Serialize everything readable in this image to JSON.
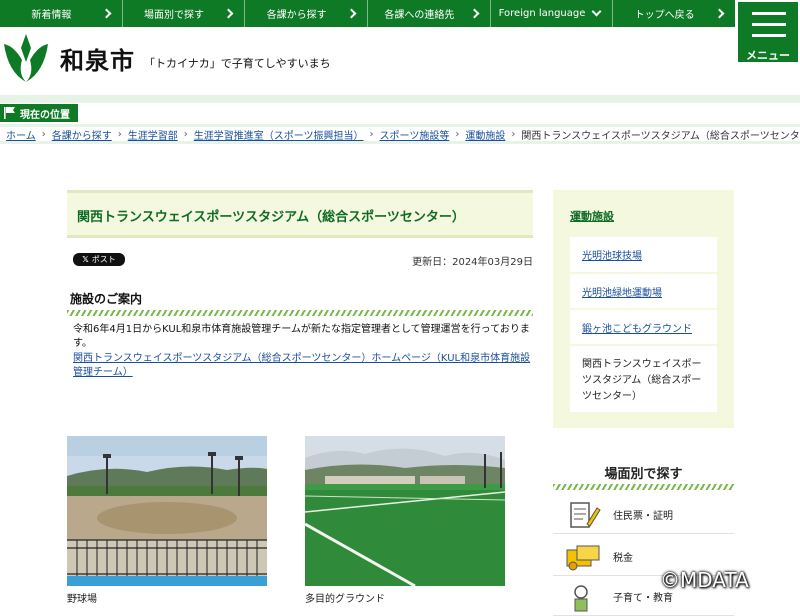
{
  "topnav": {
    "items": [
      {
        "label": "新着情報",
        "arrow": "right"
      },
      {
        "label": "場面別で探す",
        "arrow": "right"
      },
      {
        "label": "各課から探す",
        "arrow": "right"
      },
      {
        "label": "各課への連絡先",
        "arrow": "right"
      },
      {
        "label": "Foreign language",
        "arrow": "down"
      },
      {
        "label": "トップへ戻る",
        "arrow": "right"
      }
    ],
    "menu_label": "メニュー"
  },
  "header": {
    "logo_icon": "izumi-city-emblem",
    "site_name": "和泉市",
    "tagline": "「トカイナカ」で子育てしやすいまち"
  },
  "location": {
    "badge_label": "現在の位置",
    "breadcrumb": [
      "ホーム",
      "各課から探す",
      "生涯学習部",
      "生涯学習推進室（スポーツ振興担当）",
      "スポーツ施設等",
      "運動施設"
    ],
    "current": "関西トランスウェイスポーツスタジアム（総合スポーツセンター）",
    "separator": "›"
  },
  "main": {
    "page_title": "関西トランスウェイスポーツスタジアム（総合スポーツセンター）",
    "share_button": "ポスト",
    "updated": "更新日：2024年03月29日",
    "section_heading": "施設のご案内",
    "body_text": "令和6年4月1日からKUL和泉市体育施設管理チームが新たな指定管理者として管理運営を行っております。",
    "link_text": "関西トランスウェイスポーツスタジアム（総合スポーツセンター）ホームページ（KUL和泉市体育施設管理チーム）",
    "photos": [
      {
        "caption": "野球場"
      },
      {
        "caption": "多目的グラウンド"
      }
    ]
  },
  "sidebar": {
    "title": "運動施設",
    "items": [
      {
        "label": "光明池球技場"
      },
      {
        "label": "光明池緑地運動場"
      },
      {
        "label": "鍛ヶ池こどもグラウンド"
      }
    ],
    "current_item": "関西トランスウェイスポーツスタジアム（総合スポーツセンター）"
  },
  "scene": {
    "title": "場面別で探す",
    "items": [
      {
        "label": "住民票・証明",
        "icon": "document-pen-icon"
      },
      {
        "label": "税金",
        "icon": "tax-money-icon"
      },
      {
        "label": "子育て・教育",
        "icon": "child-icon"
      }
    ]
  },
  "watermark": "©MDATA",
  "colors": {
    "primary_green": "#0f7a26",
    "title_bg": "#f3f8df",
    "link_blue": "#1a4f9c"
  }
}
